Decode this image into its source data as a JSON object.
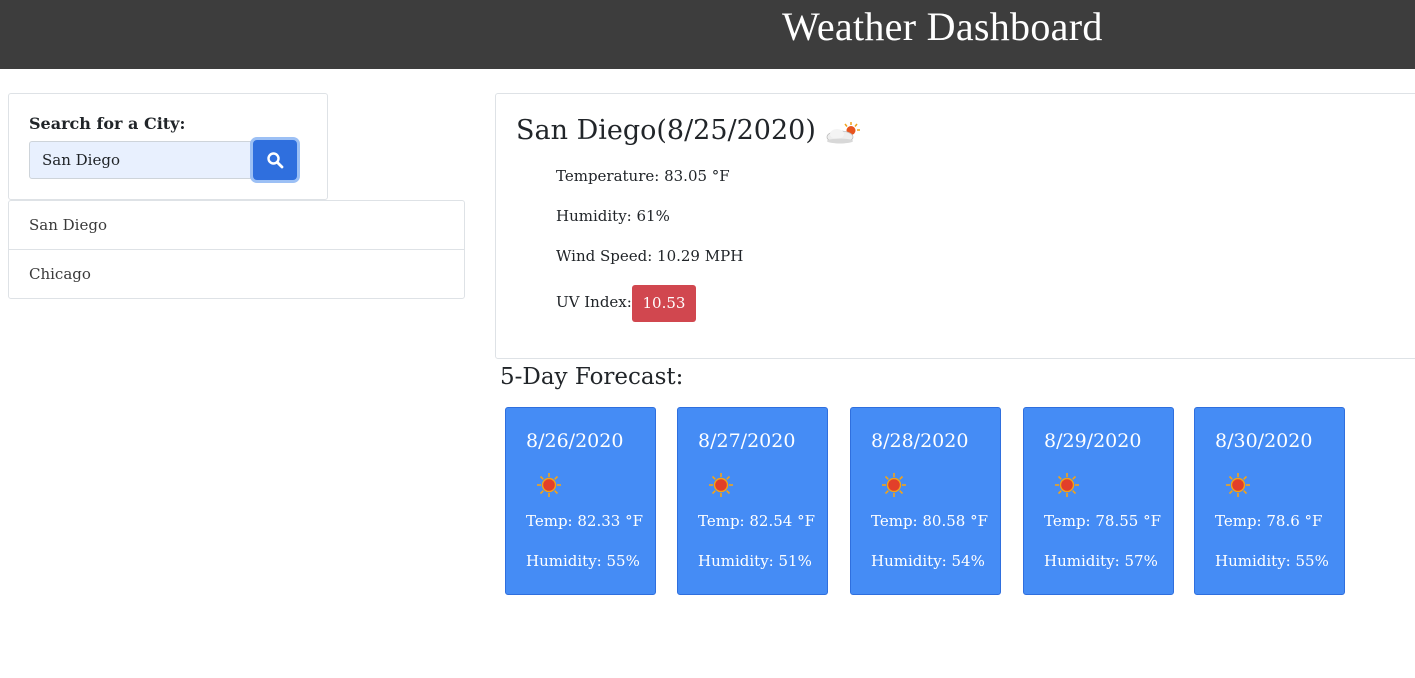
{
  "header": {
    "title": "Weather Dashboard"
  },
  "search": {
    "label": "Search for a City:",
    "value": "San Diego",
    "button_icon": "search-icon"
  },
  "history": [
    "San Diego",
    "Chicago"
  ],
  "current": {
    "title": "San Diego(8/25/2020)",
    "icon": "partly-cloudy-icon",
    "temperature": "Temperature: 83.05 °F",
    "humidity": "Humidity: 61%",
    "wind": "Wind Speed: 10.29 MPH",
    "uv_label": "UV Index:",
    "uv_value": "10.53",
    "uv_color": "#d1474f"
  },
  "forecast": {
    "title": "5-Day Forecast:",
    "days": [
      {
        "date": "8/26/2020",
        "icon": "sun-icon",
        "temp": "Temp: 82.33 °F",
        "humidity": "Humidity: 55%"
      },
      {
        "date": "8/27/2020",
        "icon": "sun-icon",
        "temp": "Temp: 82.54 °F",
        "humidity": "Humidity: 51%"
      },
      {
        "date": "8/28/2020",
        "icon": "sun-icon",
        "temp": "Temp: 80.58 °F",
        "humidity": "Humidity: 54%"
      },
      {
        "date": "8/29/2020",
        "icon": "sun-icon",
        "temp": "Temp: 78.55 °F",
        "humidity": "Humidity: 57%"
      },
      {
        "date": "8/30/2020",
        "icon": "sun-icon",
        "temp": "Temp: 78.6 °F",
        "humidity": "Humidity: 55%"
      }
    ]
  },
  "colors": {
    "header_bg": "#3d3d3d",
    "card_blue": "#458cf5",
    "button_blue": "#2f6fde"
  }
}
